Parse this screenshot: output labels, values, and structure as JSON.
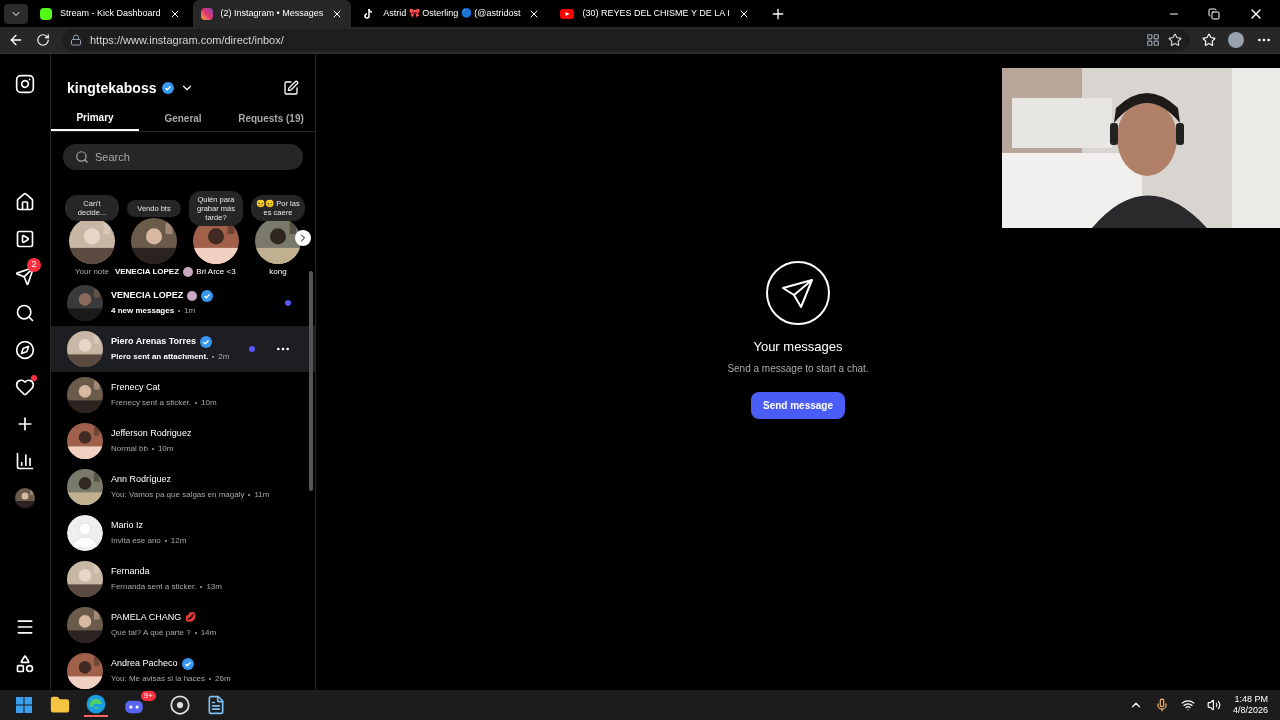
{
  "browser": {
    "tabs": [
      {
        "kind": "kick",
        "title": "Stream - Kick Dashboard",
        "selected": false
      },
      {
        "kind": "instagram",
        "title": "(2) Instagram • Messages",
        "selected": true
      },
      {
        "kind": "tiktok",
        "title": "Astrid 🎀 Osterling 🔵 (@astridost",
        "selected": false
      },
      {
        "kind": "youtube",
        "title": "(30) REYES DEL CHISME Y DE LA I",
        "selected": false
      }
    ],
    "url": "https://www.instagram.com/direct/inbox/"
  },
  "nav": [
    {
      "kind": "logo"
    },
    {
      "kind": "home"
    },
    {
      "kind": "reels"
    },
    {
      "kind": "messages",
      "badge": "2"
    },
    {
      "kind": "search"
    },
    {
      "kind": "explore"
    },
    {
      "kind": "heart",
      "dot": true
    },
    {
      "kind": "create"
    },
    {
      "kind": "dashboard"
    },
    {
      "kind": "profile"
    },
    {
      "kind": "menu"
    },
    {
      "kind": "apps"
    }
  ],
  "inbox": {
    "username": "kingtekaboss",
    "verified": true,
    "tabs": [
      {
        "label": "Primary",
        "selected": true
      },
      {
        "label": "General",
        "selected": false
      },
      {
        "label": "Requests (19)",
        "selected": false
      }
    ],
    "search": {
      "placeholder": "Search"
    },
    "notes": [
      {
        "note": "Can't decide...",
        "name": "Your note",
        "own": true
      },
      {
        "note": "Vendo bts",
        "name": "VENECIA LOPEZ",
        "sticker": true
      },
      {
        "note": "Quién para grabar más tarde?",
        "name": "Bri Arce <3"
      },
      {
        "note": "😣😣 Por las es caere",
        "name": "kong"
      }
    ],
    "conversations": [
      {
        "name": "VENECIA LOPEZ",
        "sticker": true,
        "verified": true,
        "preview": "4 new messages",
        "time": "1m",
        "unread": true,
        "selected": false
      },
      {
        "name": "Piero Arenas Torres",
        "verified": true,
        "preview": "Piero sent an attachment.",
        "time": "2m",
        "unread": true,
        "selected": true
      },
      {
        "name": "Frenecy Cat",
        "verified": false,
        "preview": "Frenecy sent a sticker.",
        "time": "10m",
        "unread": false,
        "selected": false
      },
      {
        "name": "Jefferson Rodriguez",
        "verified": false,
        "preview": "Normal bb",
        "time": "10m",
        "unread": false,
        "selected": false
      },
      {
        "name": "Ann Rodríguez",
        "verified": false,
        "preview": "You: Vamos pa que salgas en magaly",
        "time": "11m",
        "unread": false,
        "selected": false
      },
      {
        "name": "Mario Iz",
        "verified": false,
        "preview": "Invita ese ano",
        "time": "12m",
        "unread": false,
        "selected": false,
        "kind": "default"
      },
      {
        "name": "Fernanda",
        "verified": false,
        "preview": "Fernanda sent a sticker.",
        "time": "13m",
        "unread": false,
        "selected": false
      },
      {
        "name": "PAMELA CHANG",
        "emoji": "💋",
        "verified": false,
        "preview": "Qué tal? A qué parte ?",
        "time": "14m",
        "unread": false,
        "selected": false
      },
      {
        "name": "Andrea Pacheco",
        "verified": true,
        "preview": "You: Me avisas si la haces",
        "time": "26m",
        "unread": false,
        "selected": false
      }
    ]
  },
  "empty": {
    "title": "Your messages",
    "subtitle": "Send a message to start a chat.",
    "button": "Send message"
  },
  "taskbar": {
    "apps": [
      {
        "kind": "windows"
      },
      {
        "kind": "folder"
      },
      {
        "kind": "edge",
        "active": true
      },
      {
        "kind": "discord",
        "badge": "9+"
      },
      {
        "kind": "obs"
      },
      {
        "kind": "notepad"
      }
    ],
    "time": "1:48 PM",
    "date": "4/8/2026"
  }
}
